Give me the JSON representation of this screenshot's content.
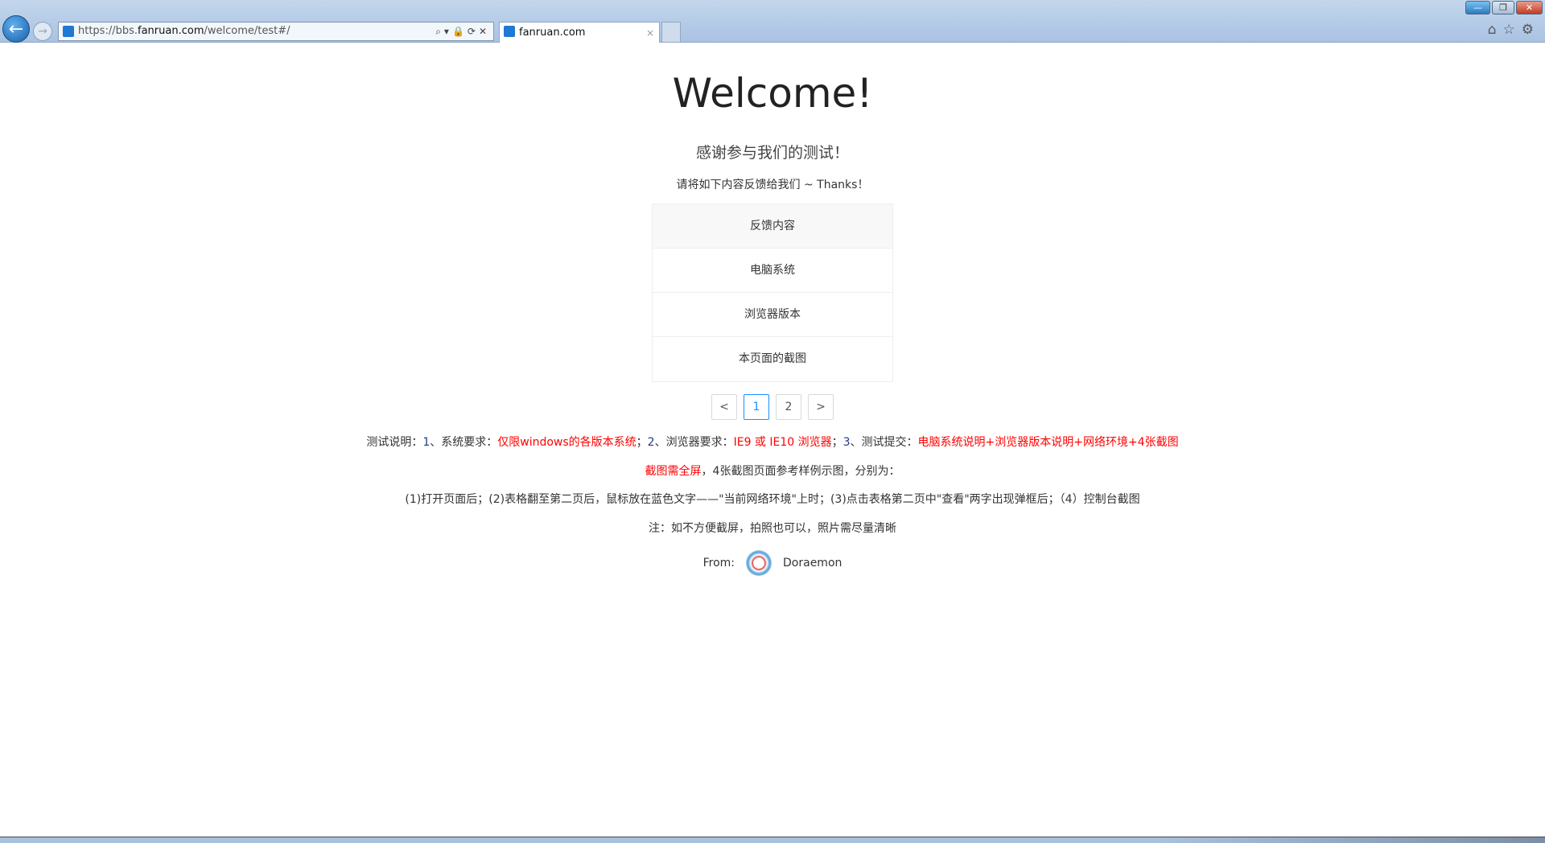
{
  "browser": {
    "url_prefix": "https://bbs.",
    "url_domain": "fanruan.com",
    "url_path": "/welcome/test#/",
    "tab_title": "fanruan.com",
    "tab_close": "×",
    "back": "←",
    "forward": "→",
    "addr_icons": "⌕▾🔒⟳✕",
    "win_min": "—",
    "win_max": "❐",
    "win_close": "✕",
    "tools": "⌂☆⚙"
  },
  "page": {
    "title": "Welcome!",
    "subtitle": "感谢参与我们的测试！",
    "ask": "请将如下内容反馈给我们 ~ Thanks！",
    "table": {
      "header": "反馈内容",
      "rows": [
        "电脑系统",
        "浏览器版本",
        "本页面的截图"
      ]
    },
    "pager": {
      "prev": "<",
      "pages": [
        "1",
        "2"
      ],
      "next": ">",
      "current": "1"
    },
    "desc": {
      "l1": [
        {
          "t": "测试说明：",
          "c": ""
        },
        {
          "t": "1",
          "c": "blue"
        },
        {
          "t": "、系统要求：",
          "c": ""
        },
        {
          "t": "仅限windows的各版本系统",
          "c": "red"
        },
        {
          "t": "；",
          "c": ""
        },
        {
          "t": "2",
          "c": "blue"
        },
        {
          "t": "、浏览器要求：",
          "c": ""
        },
        {
          "t": "IE9 或 IE10 浏览器",
          "c": "red"
        },
        {
          "t": "；",
          "c": ""
        },
        {
          "t": "3",
          "c": "blue"
        },
        {
          "t": "、测试提交：",
          "c": ""
        },
        {
          "t": "电脑系统说明+浏览器版本说明+网络环境+4张截图",
          "c": "red"
        }
      ],
      "l2": [
        {
          "t": "截图需全屏",
          "c": "red"
        },
        {
          "t": "，4张截图页面参考样例示图，分别为：",
          "c": ""
        }
      ],
      "l3": "(1)打开页面后；(2)表格翻至第二页后，鼠标放在蓝色文字——\"当前网络环境\"上时；(3)点击表格第二页中\"查看\"两字出现弹框后；（4）控制台截图",
      "l4": "注：如不方便截屏，拍照也可以，照片需尽量清晰"
    },
    "from_label": "From:",
    "from_name": "Doraemon"
  },
  "colors": {
    "red": "#ff0000",
    "accent": "#1890ff"
  }
}
